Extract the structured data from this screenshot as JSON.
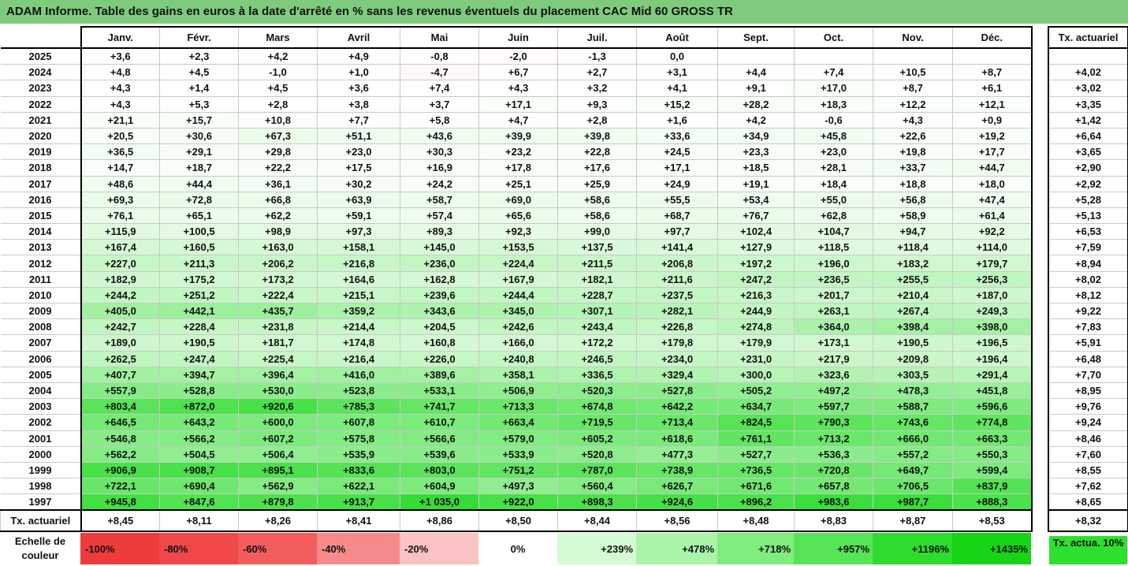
{
  "title": "ADAM Informe. Table des gains en euros à la date d'arrêté en % sans les revenus éventuels du placement CAC Mid 60 GROSS TR",
  "months": [
    "Janv.",
    "Févr.",
    "Mars",
    "Avril",
    "Mai",
    "Juin",
    "Juil.",
    "Août",
    "Sept.",
    "Oct.",
    "Nov.",
    "Déc."
  ],
  "rate_header": "Tx. actuariel",
  "rows": [
    {
      "year": "2025",
      "values": [
        "+3,6",
        "+2,3",
        "+4,2",
        "+4,9",
        "-0,8",
        "-2,0",
        "-1,3",
        "0,0",
        "",
        "",
        "",
        ""
      ],
      "rate": ""
    },
    {
      "year": "2024",
      "values": [
        "+4,8",
        "+4,5",
        "-1,0",
        "+1,0",
        "-4,7",
        "+6,7",
        "+2,7",
        "+3,1",
        "+4,4",
        "+7,4",
        "+10,5",
        "+8,7"
      ],
      "rate": "+4,02"
    },
    {
      "year": "2023",
      "values": [
        "+4,3",
        "+1,4",
        "+4,5",
        "+3,6",
        "+7,4",
        "+4,3",
        "+3,2",
        "+4,1",
        "+9,1",
        "+17,0",
        "+8,7",
        "+6,1"
      ],
      "rate": "+3,02"
    },
    {
      "year": "2022",
      "values": [
        "+4,3",
        "+5,3",
        "+2,8",
        "+3,8",
        "+3,7",
        "+17,1",
        "+9,3",
        "+15,2",
        "+28,2",
        "+18,3",
        "+12,2",
        "+12,1"
      ],
      "rate": "+3,35"
    },
    {
      "year": "2021",
      "values": [
        "+21,1",
        "+15,7",
        "+10,8",
        "+7,7",
        "+5,8",
        "+4,7",
        "+2,8",
        "+1,6",
        "+4,2",
        "-0,6",
        "+4,3",
        "+0,9"
      ],
      "rate": "+1,42"
    },
    {
      "year": "2020",
      "values": [
        "+20,5",
        "+30,6",
        "+67,3",
        "+51,1",
        "+43,6",
        "+39,9",
        "+39,8",
        "+33,6",
        "+34,9",
        "+45,8",
        "+22,6",
        "+19,2"
      ],
      "rate": "+6,64"
    },
    {
      "year": "2019",
      "values": [
        "+36,5",
        "+29,1",
        "+29,8",
        "+23,0",
        "+30,3",
        "+23,2",
        "+22,8",
        "+24,5",
        "+23,3",
        "+23,0",
        "+19,8",
        "+17,7"
      ],
      "rate": "+3,65"
    },
    {
      "year": "2018",
      "values": [
        "+14,7",
        "+18,7",
        "+22,2",
        "+17,5",
        "+16,9",
        "+17,8",
        "+17,6",
        "+17,1",
        "+18,5",
        "+28,1",
        "+33,7",
        "+44,7"
      ],
      "rate": "+2,90"
    },
    {
      "year": "2017",
      "values": [
        "+48,6",
        "+44,4",
        "+36,1",
        "+30,2",
        "+24,2",
        "+25,1",
        "+25,9",
        "+24,9",
        "+19,1",
        "+18,4",
        "+18,8",
        "+18,0"
      ],
      "rate": "+2,92"
    },
    {
      "year": "2016",
      "values": [
        "+69,3",
        "+72,8",
        "+66,8",
        "+63,9",
        "+58,7",
        "+69,0",
        "+58,6",
        "+55,5",
        "+53,4",
        "+55,0",
        "+56,8",
        "+47,4"
      ],
      "rate": "+5,28"
    },
    {
      "year": "2015",
      "values": [
        "+76,1",
        "+65,1",
        "+62,2",
        "+59,1",
        "+57,4",
        "+65,6",
        "+58,6",
        "+68,7",
        "+76,7",
        "+62,8",
        "+58,9",
        "+61,4"
      ],
      "rate": "+5,13"
    },
    {
      "year": "2014",
      "values": [
        "+115,9",
        "+100,5",
        "+98,9",
        "+97,3",
        "+89,3",
        "+92,3",
        "+99,0",
        "+97,7",
        "+102,4",
        "+104,7",
        "+94,7",
        "+92,2"
      ],
      "rate": "+6,53"
    },
    {
      "year": "2013",
      "values": [
        "+167,4",
        "+160,5",
        "+163,0",
        "+158,1",
        "+145,0",
        "+153,5",
        "+137,5",
        "+141,4",
        "+127,9",
        "+118,5",
        "+118,4",
        "+114,0"
      ],
      "rate": "+7,59"
    },
    {
      "year": "2012",
      "values": [
        "+227,0",
        "+211,3",
        "+206,2",
        "+216,8",
        "+236,0",
        "+224,4",
        "+211,5",
        "+206,8",
        "+197,2",
        "+196,0",
        "+183,2",
        "+179,7"
      ],
      "rate": "+8,94"
    },
    {
      "year": "2011",
      "values": [
        "+182,9",
        "+175,2",
        "+173,2",
        "+164,6",
        "+162,8",
        "+167,9",
        "+182,1",
        "+211,6",
        "+247,2",
        "+236,5",
        "+255,5",
        "+256,3"
      ],
      "rate": "+8,02"
    },
    {
      "year": "2010",
      "values": [
        "+244,2",
        "+251,2",
        "+222,4",
        "+215,1",
        "+239,6",
        "+244,4",
        "+228,7",
        "+237,5",
        "+216,3",
        "+201,7",
        "+210,4",
        "+187,0"
      ],
      "rate": "+8,12"
    },
    {
      "year": "2009",
      "values": [
        "+405,0",
        "+442,1",
        "+435,7",
        "+359,2",
        "+343,6",
        "+345,0",
        "+307,1",
        "+282,1",
        "+244,9",
        "+263,1",
        "+267,4",
        "+249,3"
      ],
      "rate": "+9,22"
    },
    {
      "year": "2008",
      "values": [
        "+242,7",
        "+228,4",
        "+231,8",
        "+214,4",
        "+204,5",
        "+242,6",
        "+243,4",
        "+226,8",
        "+274,8",
        "+364,0",
        "+398,4",
        "+398,0"
      ],
      "rate": "+7,83"
    },
    {
      "year": "2007",
      "values": [
        "+189,0",
        "+190,5",
        "+181,7",
        "+174,8",
        "+160,8",
        "+166,0",
        "+172,2",
        "+179,8",
        "+179,9",
        "+173,1",
        "+190,5",
        "+196,5"
      ],
      "rate": "+5,91"
    },
    {
      "year": "2006",
      "values": [
        "+262,5",
        "+247,4",
        "+225,4",
        "+216,4",
        "+226,0",
        "+240,8",
        "+246,5",
        "+234,0",
        "+231,0",
        "+217,9",
        "+209,8",
        "+196,4"
      ],
      "rate": "+6,48"
    },
    {
      "year": "2005",
      "values": [
        "+407,7",
        "+394,7",
        "+396,4",
        "+416,0",
        "+389,6",
        "+358,1",
        "+336,5",
        "+329,4",
        "+300,0",
        "+323,6",
        "+303,5",
        "+291,4"
      ],
      "rate": "+7,70"
    },
    {
      "year": "2004",
      "values": [
        "+557,9",
        "+528,8",
        "+530,0",
        "+523,8",
        "+533,1",
        "+506,9",
        "+520,3",
        "+527,8",
        "+505,2",
        "+497,2",
        "+478,3",
        "+451,8"
      ],
      "rate": "+8,95"
    },
    {
      "year": "2003",
      "values": [
        "+803,4",
        "+872,0",
        "+920,6",
        "+785,3",
        "+741,7",
        "+713,3",
        "+674,8",
        "+642,2",
        "+634,7",
        "+597,7",
        "+588,7",
        "+596,6"
      ],
      "rate": "+9,76"
    },
    {
      "year": "2002",
      "values": [
        "+646,5",
        "+643,2",
        "+600,0",
        "+607,8",
        "+610,7",
        "+663,4",
        "+719,5",
        "+713,4",
        "+824,5",
        "+790,3",
        "+743,6",
        "+774,8"
      ],
      "rate": "+9,24"
    },
    {
      "year": "2001",
      "values": [
        "+546,8",
        "+566,2",
        "+607,2",
        "+575,8",
        "+566,6",
        "+579,0",
        "+605,2",
        "+618,6",
        "+761,1",
        "+713,2",
        "+666,0",
        "+663,3"
      ],
      "rate": "+8,46"
    },
    {
      "year": "2000",
      "values": [
        "+562,2",
        "+504,5",
        "+506,4",
        "+535,9",
        "+539,6",
        "+533,9",
        "+520,8",
        "+477,3",
        "+527,7",
        "+536,3",
        "+557,2",
        "+550,3"
      ],
      "rate": "+7,60"
    },
    {
      "year": "1999",
      "values": [
        "+906,9",
        "+908,7",
        "+895,1",
        "+833,6",
        "+803,0",
        "+751,2",
        "+787,0",
        "+738,9",
        "+736,5",
        "+720,8",
        "+649,7",
        "+599,4"
      ],
      "rate": "+8,55"
    },
    {
      "year": "1998",
      "values": [
        "+722,1",
        "+690,4",
        "+562,9",
        "+622,1",
        "+604,9",
        "+497,3",
        "+560,4",
        "+626,7",
        "+671,6",
        "+657,8",
        "+706,5",
        "+837,9"
      ],
      "rate": "+7,62"
    },
    {
      "year": "1997",
      "values": [
        "+945,8",
        "+847,6",
        "+879,8",
        "+913,7",
        "+1 035,0",
        "+922,0",
        "+898,3",
        "+924,6",
        "+896,2",
        "+983,6",
        "+987,7",
        "+888,3"
      ],
      "rate": "+8,65"
    }
  ],
  "footer": {
    "label": "Tx. actuariel",
    "values": [
      "+8,45",
      "+8,11",
      "+8,26",
      "+8,41",
      "+8,86",
      "+8,50",
      "+8,44",
      "+8,56",
      "+8,48",
      "+8,83",
      "+8,87",
      "+8,53"
    ],
    "rate": "+8,32"
  },
  "legend": {
    "label": "Echelle de couleur",
    "swatches": [
      {
        "text": "-100%",
        "color": "#ee3b3b",
        "align": "left"
      },
      {
        "text": "-80%",
        "color": "#f04848",
        "align": "left"
      },
      {
        "text": "-60%",
        "color": "#f35c5c",
        "align": "left"
      },
      {
        "text": "-40%",
        "color": "#f68a8a",
        "align": "left"
      },
      {
        "text": "-20%",
        "color": "#fac2c2",
        "align": "left"
      },
      {
        "text": "0%",
        "color": "#ffffff",
        "align": "center"
      },
      {
        "text": "+239%",
        "color": "#d4fbd4",
        "align": "right"
      },
      {
        "text": "+478%",
        "color": "#aaf4aa",
        "align": "right"
      },
      {
        "text": "+718%",
        "color": "#7eec7e",
        "align": "right"
      },
      {
        "text": "+957%",
        "color": "#56e456",
        "align": "right"
      },
      {
        "text": "+1196%",
        "color": "#2fdb2f",
        "align": "right"
      },
      {
        "text": "+1435%",
        "color": "#17d417",
        "align": "right"
      }
    ],
    "rate_label": "Tx. actua. 10%",
    "rate_color": "#2ee02e"
  }
}
